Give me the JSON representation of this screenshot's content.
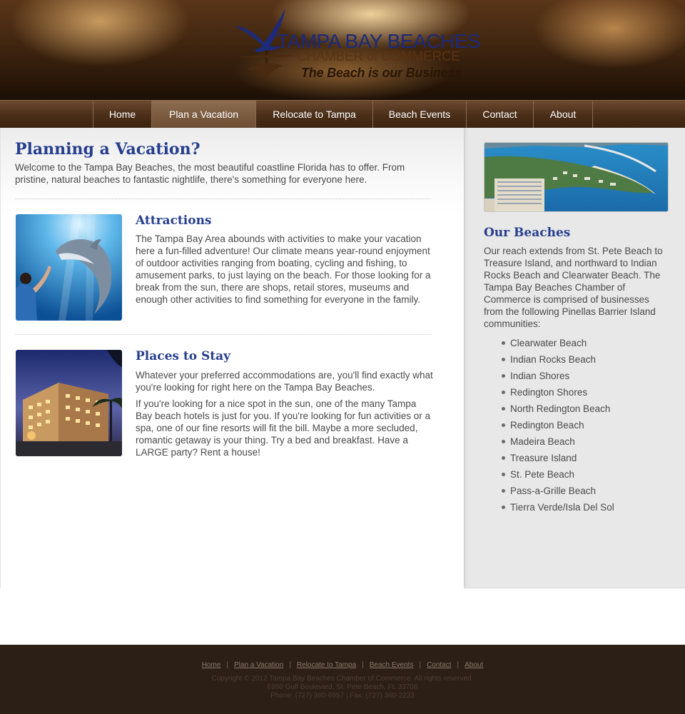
{
  "header": {
    "logo": {
      "line1": "TAMPA BAY BEACHES",
      "line2": "CHAMBER of COMMERCE",
      "tagline": "The Beach is our Business"
    }
  },
  "nav": {
    "items": [
      {
        "label": "Home",
        "active": false
      },
      {
        "label": "Plan a Vacation",
        "active": true
      },
      {
        "label": "Relocate to Tampa",
        "active": false
      },
      {
        "label": "Beach Events",
        "active": false
      },
      {
        "label": "Contact",
        "active": false
      },
      {
        "label": "About",
        "active": false
      }
    ]
  },
  "main": {
    "title": "Planning a Vacation?",
    "intro": "Welcome to the Tampa Bay Beaches, the most beautiful coastline Florida has to offer. From pristine, natural beaches to fantastic nightlife, there's something for everyone here.",
    "attractions": {
      "title": "Attractions",
      "text": "The Tampa Bay Area abounds with activities to make your vacation here a fun-filled adventure! Our climate means year-round enjoyment of outdoor activities ranging from boating, cycling and fishing, to amusement parks, to just laying on the beach. For those looking for a break from the sun, there are shops, retail stores, museums and enough other activities to find something for everyone in the family."
    },
    "places": {
      "title": "Places to Stay",
      "text1": "Whatever your preferred accommodations are, you'll find exactly what you're looking for right here on the Tampa Bay Beaches.",
      "text2": "If you're looking for a nice spot in the sun, one of the many Tampa Bay beach hotels is just for you. If you're looking for fun activities or a spa, one of our fine resorts will fit the bill. Maybe a more secluded, romantic getaway is your thing. Try a bed and breakfast. Have a LARGE party? Rent a house!"
    }
  },
  "sidebar": {
    "title": "Our Beaches",
    "text": "Our reach extends from St. Pete Beach to Treasure Island, and northward to Indian Rocks Beach and Clearwater Beach. The Tampa Bay Beaches Chamber of Commerce is comprised of businesses from the following Pinellas Barrier Island communities:",
    "beaches": [
      "Clearwater Beach",
      "Indian Rocks Beach",
      "Indian Shores",
      "Redington Shores",
      "North Redington Beach",
      "Redington Beach",
      "Madeira Beach",
      "Treasure Island",
      "St. Pete Beach",
      "Pass-a-Grille Beach",
      "Tierra Verde/Isla Del Sol"
    ]
  },
  "footer": {
    "links": [
      "Home",
      "Plan a Vacation",
      "Relocate to Tampa",
      "Beach Events",
      "Contact",
      "About"
    ],
    "separator": "|",
    "copyright": "Copyright © 2012 Tampa Bay Beaches Chamber of Commerce. All rights reserved.",
    "address": "6990 Gulf Boulevard, St. Pete Beach, FL 33706",
    "phone": "Phone: (727) 360-6957 | Fax: (727) 360-2233"
  },
  "colors": {
    "heading_blue": "#263e8e",
    "body_text": "#4a4a4a",
    "nav_brown": "#4a2e18",
    "footer_brown": "#2b1f16",
    "sidebar_gray": "#e8e8e8"
  },
  "icons": [
    "seagull-logo-icon",
    "bullet-dot-icon"
  ]
}
